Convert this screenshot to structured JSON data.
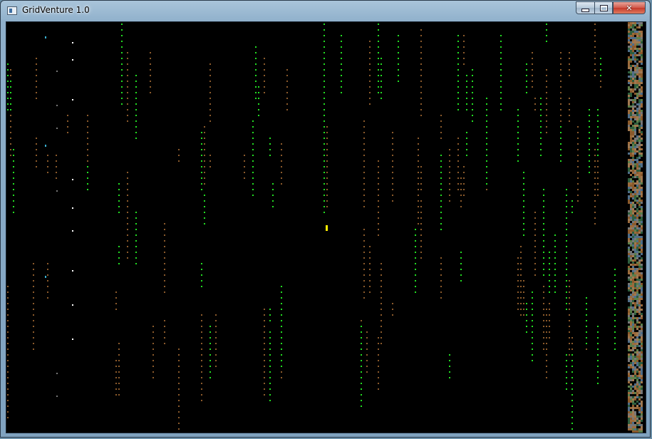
{
  "window": {
    "title": "GridVenture 1.0",
    "icon": "app-window-icon",
    "buttons": {
      "minimize_icon": "minimize-icon",
      "maximize_icon": "maximize-icon",
      "close_icon": "close-icon",
      "close_glyph": "✕"
    }
  },
  "game": {
    "background": "#000000",
    "colors": {
      "grass": "#22dd22",
      "dirt": "#8b5a2b",
      "player": "#ffee00",
      "stone": "#777777",
      "water": "#3ab0d0",
      "snow": "#ffffff"
    }
  }
}
